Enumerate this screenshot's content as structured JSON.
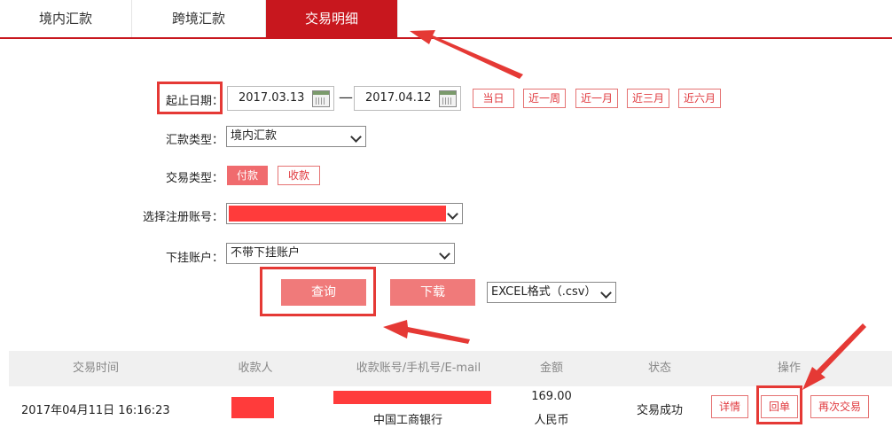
{
  "tabs": [
    {
      "label": "境内汇款"
    },
    {
      "label": "跨境汇款"
    },
    {
      "label": "交易明细"
    }
  ],
  "form": {
    "date_label": "起止日期：",
    "start_date": "2017.03.13",
    "end_date": "2017.04.12",
    "separator": "—",
    "quick_ranges": [
      "当日",
      "近一周",
      "近一月",
      "近三月",
      "近六月"
    ],
    "remit_type_label": "汇款类型：",
    "remit_type_value": "境内汇款",
    "trade_type_label": "交易类型：",
    "trade_type_options": [
      "付款",
      "收款"
    ],
    "account_label": "选择注册账号：",
    "sub_account_label": "下挂账户：",
    "sub_account_value": "不带下挂账户",
    "query_button": "查询",
    "download_button": "下载",
    "format_value": "EXCEL格式（.csv）"
  },
  "table": {
    "headers": [
      "交易时间",
      "收款人",
      "收款账号/手机号/E-mail",
      "金额",
      "状态",
      "操作"
    ],
    "rows": [
      {
        "time": "2017年04月11日 16:16:23",
        "bank": "中国工商银行",
        "amount": "169.00",
        "currency": "人民币",
        "status": "交易成功",
        "actions": [
          "详情",
          "回单",
          "再次交易"
        ]
      }
    ]
  },
  "colors": {
    "brand": "#c8171e",
    "button": "#f07a7a",
    "annotation": "#e53935",
    "redaction": "#ff3b3b"
  }
}
